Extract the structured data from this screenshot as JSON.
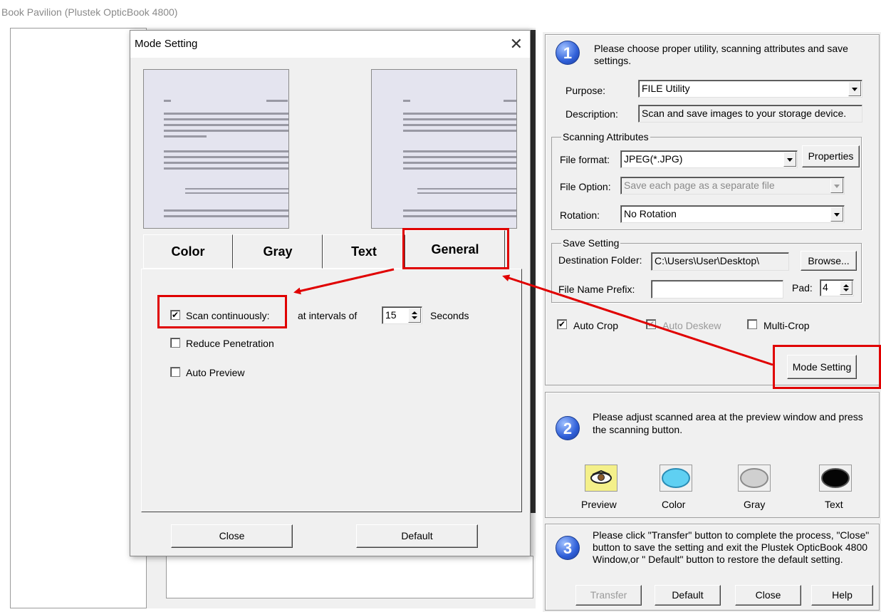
{
  "window": {
    "title": "Book Pavilion (Plustek OpticBook 4800)"
  },
  "step1": {
    "number": "1",
    "instruction": "Please choose proper utility, scanning attributes and save settings.",
    "purpose_label": "Purpose:",
    "purpose_value": "FILE Utility",
    "description_label": "Description:",
    "description_value": "Scan and save images to your storage device.",
    "scanning_attributes": {
      "group_label": "Scanning Attributes",
      "file_format_label": "File format:",
      "file_format_value": "JPEG(*.JPG)",
      "properties_button": "Properties",
      "file_option_label": "File Option:",
      "file_option_value": "Save each page as a separate file",
      "rotation_label": "Rotation:",
      "rotation_value": "No Rotation"
    },
    "save_setting": {
      "group_label": "Save Setting",
      "destination_label": "Destination Folder:",
      "destination_value": "C:\\Users\\User\\Desktop\\",
      "browse_button": "Browse...",
      "prefix_label": "File Name Prefix:",
      "prefix_value": "",
      "pad_label": "Pad:",
      "pad_value": "4"
    },
    "auto_crop": {
      "label": "Auto Crop",
      "checked": true
    },
    "auto_deskew": {
      "label": "Auto Deskew",
      "checked": true,
      "disabled": true
    },
    "multi_crop": {
      "label": "Multi-Crop",
      "checked": false
    },
    "mode_setting_button": "Mode Setting"
  },
  "step2": {
    "number": "2",
    "instruction": "Please adjust scanned area at the preview window and press the scanning button.",
    "buttons": [
      {
        "label": "Preview",
        "icon": "eye-icon"
      },
      {
        "label": "Color",
        "icon": "color-scan-icon"
      },
      {
        "label": "Gray",
        "icon": "gray-scan-icon"
      },
      {
        "label": "Text",
        "icon": "text-scan-icon"
      }
    ]
  },
  "step3": {
    "number": "3",
    "instruction": "Please click \"Transfer\" button to complete the process, \"Close\" button to save the setting and exit the Plustek OpticBook 4800 Window,or \" Default\" button to restore the default setting.",
    "transfer_button": "Transfer",
    "default_button": "Default",
    "close_button": "Close",
    "help_button": "Help"
  },
  "mode_dialog": {
    "title": "Mode Setting",
    "close_glyph": "✕",
    "tabs": [
      "Color",
      "Gray",
      "Text",
      "General"
    ],
    "active_tab": "General",
    "scan_continuously": {
      "label": "Scan continuously:",
      "checked": true
    },
    "intervals_label": "at intervals of",
    "interval_value": "15",
    "seconds_label": "Seconds",
    "reduce_penetration": {
      "label": "Reduce Penetration",
      "checked": false
    },
    "auto_preview": {
      "label": "Auto Preview",
      "checked": false
    },
    "close_button": "Close",
    "default_button": "Default"
  },
  "colors": {
    "annotation": "#e00000",
    "step_badge": "#2f5fd8"
  }
}
